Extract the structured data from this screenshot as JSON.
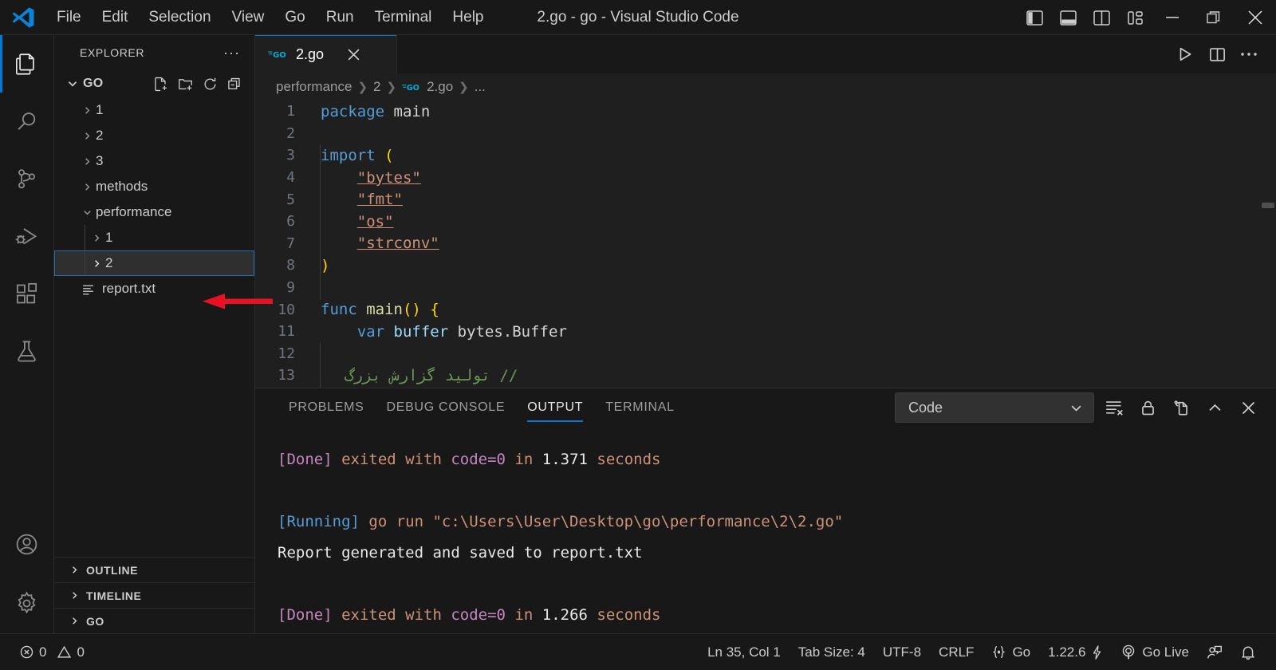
{
  "window": {
    "title": "2.go - go - Visual Studio Code",
    "menu": [
      "File",
      "Edit",
      "Selection",
      "View",
      "Go",
      "Run",
      "Terminal",
      "Help"
    ],
    "layout_buttons": [
      {
        "name": "toggle-primary-sidebar",
        "label": "Toggle Primary Side Bar"
      },
      {
        "name": "toggle-panel",
        "label": "Toggle Panel"
      },
      {
        "name": "toggle-secondary-sidebar",
        "label": "Toggle Secondary Side Bar"
      },
      {
        "name": "customize-layout",
        "label": "Customize Layout"
      }
    ],
    "controls": [
      "minimize",
      "restore",
      "close"
    ]
  },
  "activitybar": {
    "items": [
      {
        "name": "explorer",
        "icon": "files-icon",
        "active": true
      },
      {
        "name": "search",
        "icon": "search-icon",
        "active": false
      },
      {
        "name": "source-control",
        "icon": "source-control-icon",
        "active": false
      },
      {
        "name": "run-and-debug",
        "icon": "run-debug-icon",
        "active": false
      },
      {
        "name": "extensions",
        "icon": "extensions-icon",
        "active": false
      },
      {
        "name": "testing",
        "icon": "beaker-icon",
        "active": false
      }
    ],
    "bottom": [
      {
        "name": "accounts",
        "icon": "account-icon"
      },
      {
        "name": "manage",
        "icon": "gear-icon"
      }
    ]
  },
  "sidebar": {
    "header_title": "EXPLORER",
    "more_actions": "···",
    "folder": {
      "name": "GO",
      "expanded": true,
      "actions": [
        "new-file",
        "new-folder",
        "refresh",
        "collapse-all"
      ]
    },
    "tree": [
      {
        "label": "1",
        "type": "folder",
        "expanded": false,
        "depth": 1,
        "selected": false
      },
      {
        "label": "2",
        "type": "folder",
        "expanded": false,
        "depth": 1,
        "selected": false
      },
      {
        "label": "3",
        "type": "folder",
        "expanded": false,
        "depth": 1,
        "selected": false
      },
      {
        "label": "methods",
        "type": "folder",
        "expanded": false,
        "depth": 1,
        "selected": false
      },
      {
        "label": "performance",
        "type": "folder",
        "expanded": true,
        "depth": 1,
        "selected": false
      },
      {
        "label": "1",
        "type": "folder",
        "expanded": false,
        "depth": 2,
        "selected": false
      },
      {
        "label": "2",
        "type": "folder",
        "expanded": false,
        "depth": 2,
        "selected": true
      },
      {
        "label": "report.txt",
        "type": "file",
        "depth": 1,
        "selected": false
      }
    ],
    "sections": [
      "OUTLINE",
      "TIMELINE",
      "GO"
    ]
  },
  "editor": {
    "tab": {
      "label": "2.go",
      "icon": "go-file-icon",
      "close": "×"
    },
    "tabbar_actions": [
      {
        "name": "run-code",
        "icon": "play-icon"
      },
      {
        "name": "split-editor-right",
        "icon": "split-editor-icon"
      },
      {
        "name": "more-actions",
        "icon": "ellipsis-icon"
      }
    ],
    "breadcrumb": [
      "performance",
      "2",
      "2.go",
      "..."
    ],
    "lines": [
      {
        "n": 1,
        "tokens": [
          {
            "t": "package ",
            "c": "kw"
          },
          {
            "t": "main",
            "c": "plain"
          }
        ]
      },
      {
        "n": 2,
        "tokens": []
      },
      {
        "n": 3,
        "tokens": [
          {
            "t": "import ",
            "c": "kw"
          },
          {
            "t": "(",
            "c": "paren"
          }
        ]
      },
      {
        "n": 4,
        "tokens": [
          {
            "t": "    ",
            "c": "plain"
          },
          {
            "t": "\"bytes\"",
            "c": "str"
          }
        ]
      },
      {
        "n": 5,
        "tokens": [
          {
            "t": "    ",
            "c": "plain"
          },
          {
            "t": "\"fmt\"",
            "c": "str"
          }
        ]
      },
      {
        "n": 6,
        "tokens": [
          {
            "t": "    ",
            "c": "plain"
          },
          {
            "t": "\"os\"",
            "c": "str"
          }
        ]
      },
      {
        "n": 7,
        "tokens": [
          {
            "t": "    ",
            "c": "plain"
          },
          {
            "t": "\"strconv\"",
            "c": "str"
          }
        ]
      },
      {
        "n": 8,
        "tokens": [
          {
            "t": ")",
            "c": "paren"
          }
        ]
      },
      {
        "n": 9,
        "tokens": []
      },
      {
        "n": 10,
        "tokens": [
          {
            "t": "func ",
            "c": "kw"
          },
          {
            "t": "main",
            "c": "fn"
          },
          {
            "t": "()",
            "c": "paren"
          },
          {
            "t": " ",
            "c": "plain"
          },
          {
            "t": "{",
            "c": "paren"
          }
        ]
      },
      {
        "n": 11,
        "tokens": [
          {
            "t": "    ",
            "c": "plain"
          },
          {
            "t": "var ",
            "c": "kw"
          },
          {
            "t": "buffer",
            "c": "type"
          },
          {
            "t": " bytes.Buffer",
            "c": "plain"
          }
        ]
      },
      {
        "n": 12,
        "tokens": []
      },
      {
        "n": 13,
        "tokens": [
          {
            "t": "    ",
            "c": "plain"
          },
          {
            "t": "// تولید گزارش بزرگ",
            "c": "cmt"
          }
        ]
      }
    ]
  },
  "panel": {
    "tabs": [
      {
        "label": "PROBLEMS",
        "active": false
      },
      {
        "label": "DEBUG CONSOLE",
        "active": false
      },
      {
        "label": "OUTPUT",
        "active": true
      },
      {
        "label": "TERMINAL",
        "active": false
      }
    ],
    "output_channel": "Code",
    "actions": [
      {
        "name": "clear-output",
        "icon": "clear-icon"
      },
      {
        "name": "turn-auto-scrolling-off",
        "icon": "lock-icon"
      },
      {
        "name": "open-in-editor",
        "icon": "open-editor-icon"
      },
      {
        "name": "maximize-panel",
        "icon": "chevron-up-icon"
      },
      {
        "name": "close-panel",
        "icon": "close-icon"
      }
    ],
    "output_lines": [
      {
        "segments": [
          {
            "t": "[Done]",
            "c": "out-done"
          },
          {
            "t": " exited with ",
            "c": "out-orange"
          },
          {
            "t": "code=0",
            "c": "out-purple"
          },
          {
            "t": " in ",
            "c": "out-orange"
          },
          {
            "t": "1.371",
            "c": "out-white"
          },
          {
            "t": " seconds",
            "c": "out-orange"
          }
        ]
      },
      {
        "segments": []
      },
      {
        "segments": [
          {
            "t": "[Running]",
            "c": "out-run"
          },
          {
            "t": " go run \"c:\\Users\\User\\Desktop\\go\\performance\\2\\2.go\"",
            "c": "out-orange"
          }
        ]
      },
      {
        "segments": [
          {
            "t": "Report generated and saved to report.txt",
            "c": "out-white"
          }
        ]
      },
      {
        "segments": []
      },
      {
        "segments": [
          {
            "t": "[Done]",
            "c": "out-done"
          },
          {
            "t": " exited with ",
            "c": "out-orange"
          },
          {
            "t": "code=0",
            "c": "out-purple"
          },
          {
            "t": " in ",
            "c": "out-orange"
          },
          {
            "t": "1.266",
            "c": "out-white"
          },
          {
            "t": " seconds",
            "c": "out-orange"
          }
        ]
      }
    ]
  },
  "statusbar": {
    "errors": "0",
    "warnings": "0",
    "position": "Ln 35, Col 1",
    "tab_size": "Tab Size: 4",
    "encoding": "UTF-8",
    "eol": "CRLF",
    "language": "Go",
    "go_version": "1.22.6",
    "go_live": "Go Live",
    "right_icons": [
      {
        "name": "remote-feedback-icon"
      },
      {
        "name": "notifications-bell-icon"
      }
    ]
  },
  "annotation": {
    "arrow_color": "#e81123",
    "target": "report.txt"
  },
  "colors": {
    "accent": "#0078d4",
    "titlebar_bg": "#181818",
    "editor_bg": "#1f1f1f",
    "selection_border": "#1f6fb2",
    "go_blue": "#00ADD8"
  }
}
